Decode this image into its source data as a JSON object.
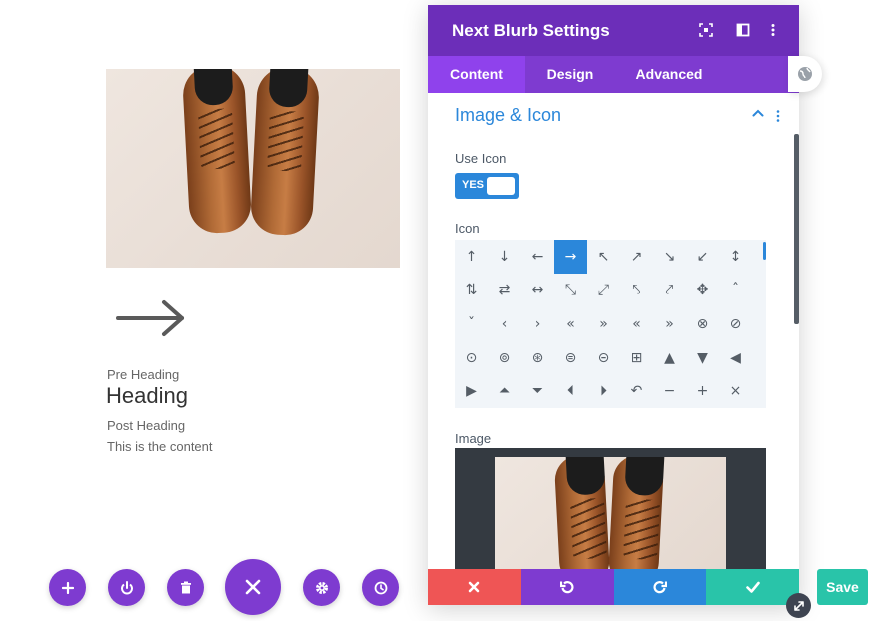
{
  "canvas": {
    "pre_heading": "Pre Heading",
    "heading": "Heading",
    "post_heading": "Post Heading",
    "content": "This is the content"
  },
  "toolbar": {
    "buttons": [
      "add-icon",
      "power-icon",
      "trash-icon",
      "close-icon",
      "gear-icon",
      "history-icon"
    ]
  },
  "modal": {
    "title": "Next Blurb Settings",
    "tabs": [
      {
        "label": "Content",
        "active": true
      },
      {
        "label": "Design",
        "active": false
      },
      {
        "label": "Advanced",
        "active": false
      }
    ],
    "section": {
      "title": "Image & Icon",
      "use_icon_label": "Use Icon",
      "toggle_text": "YES",
      "icon_label": "Icon",
      "image_label": "Image",
      "icons": [
        "↑",
        "↓",
        "←",
        "→",
        "↖",
        "↗",
        "↘",
        "↙",
        "↕",
        "⇅",
        "⇄",
        "↔",
        "⤡",
        "⤢",
        "⤣",
        "⤤",
        "✥",
        "ˆ",
        "ˇ",
        "‹",
        "›",
        "«",
        "»",
        "«",
        "»",
        "⊗",
        "⊘",
        "⊙",
        "⊚",
        "⊛",
        "⊜",
        "⊝",
        "⊞",
        "▲",
        "▼",
        "◀",
        "▶",
        "⏶",
        "⏷",
        "⏴",
        "⏵",
        "↶",
        "−",
        "+",
        "×"
      ],
      "selected_icon_index": 3
    },
    "footer": [
      "discard-icon",
      "undo-icon",
      "redo-icon",
      "check-icon"
    ]
  },
  "save_label": "Save",
  "colors": {
    "purple_dark": "#6c2eb9",
    "purple": "#7e3bd0",
    "blue": "#2b87da",
    "red": "#ef5555",
    "teal": "#29c4a9"
  }
}
